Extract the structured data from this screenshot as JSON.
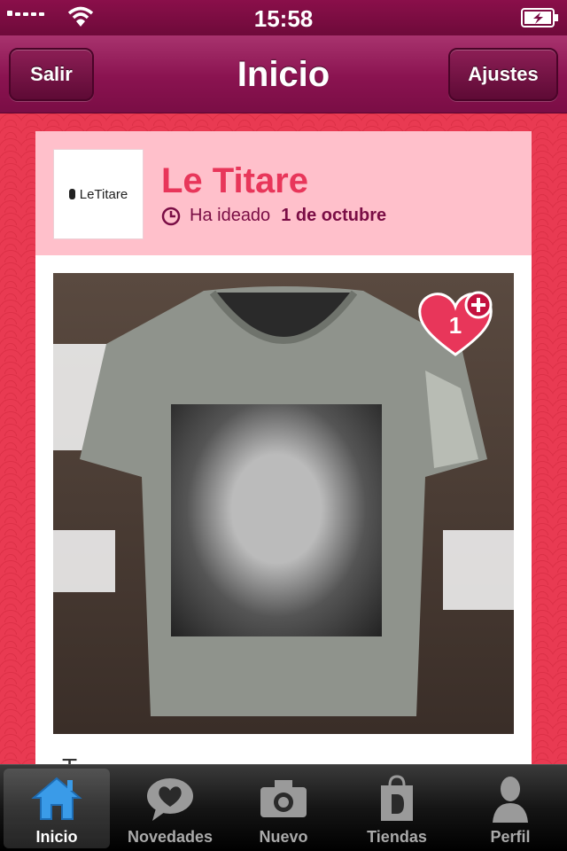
{
  "status_bar": {
    "time": "15:58",
    "signal_icon": "signal-bars-icon",
    "wifi_icon": "wifi-icon",
    "battery_icon": "battery-charging-icon"
  },
  "nav": {
    "title": "Inicio",
    "left_button": "Salir",
    "right_button": "Ajustes"
  },
  "post": {
    "store_logo_text": "LeTitare",
    "store_name": "Le Titare",
    "meta_prefix": "Ha ideado",
    "meta_date": "1 de octubre",
    "like_count": "1",
    "caption": "T"
  },
  "tab_bar": {
    "items": [
      {
        "label": "Inicio",
        "icon": "home-icon",
        "active": true
      },
      {
        "label": "Novedades",
        "icon": "heart-bubble-icon",
        "active": false
      },
      {
        "label": "Nuevo",
        "icon": "camera-icon",
        "active": false
      },
      {
        "label": "Tiendas",
        "icon": "shopping-bag-icon",
        "active": false
      },
      {
        "label": "Perfil",
        "icon": "person-icon",
        "active": false
      }
    ]
  },
  "colors": {
    "nav": "#8a1350",
    "accent": "#e8365a",
    "header_bg": "#ffc0cb",
    "tab_active": "#3a9be8"
  }
}
